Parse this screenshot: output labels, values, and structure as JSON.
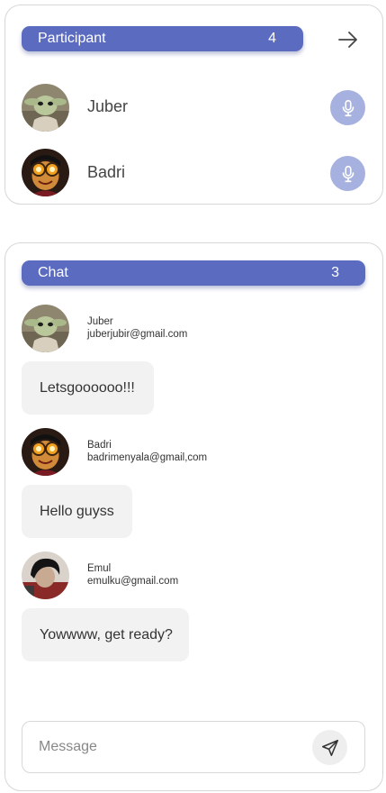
{
  "participants": {
    "title": "Participant",
    "count": "4",
    "arrow_icon": "arrow-right-icon",
    "items": [
      {
        "name": "Juber",
        "avatar": "yoda-avatar",
        "mic_icon": "mic-icon"
      },
      {
        "name": "Badri",
        "avatar": "goggles-avatar",
        "mic_icon": "mic-icon"
      }
    ]
  },
  "chat": {
    "title": "Chat",
    "count": "3",
    "messages": [
      {
        "name": "Juber",
        "email": "juberjubir@gmail.com",
        "text": "Letsgoooooo!!!",
        "avatar": "yoda-avatar"
      },
      {
        "name": "Badri",
        "email": "badrimenyala@gmail,com",
        "text": "Hello guyss",
        "avatar": "goggles-avatar"
      },
      {
        "name": "Emul",
        "email": "emulku@gmail.com",
        "text": "Yowwww, get ready?",
        "avatar": "dark-hair-avatar"
      }
    ],
    "input_placeholder": "Message",
    "send_icon": "send-icon"
  },
  "colors": {
    "accent": "#5b6bc0",
    "mic_button": "#a7b1df",
    "bubble": "#f2f2f2"
  }
}
